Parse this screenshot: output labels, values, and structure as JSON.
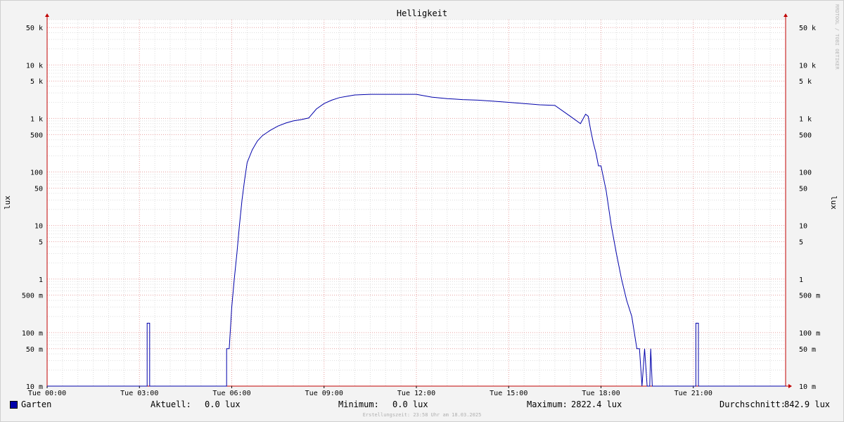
{
  "chart_data": {
    "type": "line",
    "title": "Helligkeit",
    "ylabel": "lux",
    "xlabel": "",
    "y_scale": "log",
    "ylim": [
      0.01,
      70000
    ],
    "xlim_hours": [
      0,
      24
    ],
    "x_ticks": [
      {
        "hour": 0,
        "label": "Tue 00:00"
      },
      {
        "hour": 3,
        "label": "Tue 03:00"
      },
      {
        "hour": 6,
        "label": "Tue 06:00"
      },
      {
        "hour": 9,
        "label": "Tue 09:00"
      },
      {
        "hour": 12,
        "label": "Tue 12:00"
      },
      {
        "hour": 15,
        "label": "Tue 15:00"
      },
      {
        "hour": 18,
        "label": "Tue 18:00"
      },
      {
        "hour": 21,
        "label": "Tue 21:00"
      }
    ],
    "y_ticks": [
      {
        "value": 0.01,
        "label": "10 m"
      },
      {
        "value": 0.05,
        "label": "50 m"
      },
      {
        "value": 0.1,
        "label": "100 m"
      },
      {
        "value": 0.5,
        "label": "500 m"
      },
      {
        "value": 1,
        "label": "1"
      },
      {
        "value": 5,
        "label": "5"
      },
      {
        "value": 10,
        "label": "10"
      },
      {
        "value": 50,
        "label": "50"
      },
      {
        "value": 100,
        "label": "100"
      },
      {
        "value": 500,
        "label": "500"
      },
      {
        "value": 1000,
        "label": "1 k"
      },
      {
        "value": 5000,
        "label": "5 k"
      },
      {
        "value": 10000,
        "label": "10 k"
      },
      {
        "value": 50000,
        "label": "50 k"
      }
    ],
    "grid": true,
    "series": [
      {
        "name": "Garten",
        "color": "#0000aa",
        "x": [
          "00:00",
          "03:15",
          "03:15",
          "03:20",
          "03:20",
          "05:50",
          "05:50",
          "05:55",
          "05:57",
          "06:00",
          "06:05",
          "06:10",
          "06:15",
          "06:20",
          "06:25",
          "06:30",
          "06:40",
          "06:50",
          "07:00",
          "07:15",
          "07:30",
          "07:45",
          "08:00",
          "08:15",
          "08:30",
          "08:45",
          "09:00",
          "09:15",
          "09:30",
          "09:45",
          "10:00",
          "10:30",
          "11:00",
          "11:30",
          "12:00",
          "12:30",
          "13:00",
          "13:15",
          "13:30",
          "14:00",
          "14:30",
          "15:00",
          "15:30",
          "16:00",
          "16:30",
          "17:00",
          "17:20",
          "17:30",
          "17:35",
          "17:40",
          "17:45",
          "17:50",
          "17:55",
          "18:00",
          "18:10",
          "18:20",
          "18:30",
          "18:40",
          "18:50",
          "19:00",
          "19:10",
          "19:15",
          "19:20",
          "19:25",
          "19:30",
          "19:35",
          "19:37",
          "19:40",
          "19:42",
          "19:45",
          "19:50",
          "19:52",
          "19:55",
          "20:00",
          "21:05",
          "21:05",
          "21:10",
          "21:10",
          "24:00"
        ],
        "y": [
          0.01,
          0.01,
          0.15,
          0.15,
          0.01,
          0.01,
          0.05,
          0.05,
          0.1,
          0.3,
          1,
          3,
          10,
          30,
          70,
          150,
          260,
          380,
          480,
          600,
          720,
          820,
          900,
          950,
          1020,
          1500,
          1900,
          2200,
          2450,
          2600,
          2750,
          2822,
          2822,
          2822,
          2822,
          2500,
          2350,
          2300,
          2250,
          2200,
          2100,
          2000,
          1900,
          1800,
          1750,
          1100,
          800,
          1200,
          1100,
          600,
          350,
          230,
          130,
          130,
          45,
          10,
          3,
          1,
          0.4,
          0.2,
          0.05,
          0.05,
          0.01,
          0.05,
          0.01,
          0.01,
          0.05,
          0.01,
          0.01,
          0.01,
          0.01,
          0.01,
          0.01,
          0.01,
          0.01,
          0.15,
          0.15,
          0.01,
          0.01
        ]
      }
    ]
  },
  "legend": {
    "series_name": "Garten",
    "current_label": "Aktuell:",
    "current_value": "0.0 lux",
    "min_label": "Minimum:",
    "min_value": "0.0 lux",
    "max_label": "Maximum:",
    "max_value": "2822.4 lux",
    "avg_label": "Durchschnitt:",
    "avg_value": "842.9 lux"
  },
  "footer": {
    "created": "Erstellungszeit: 23:58 Uhr am 18.03.2025"
  },
  "watermark": "RRDTOOL / TOBI OETIKER",
  "colors": {
    "plot_background": "#ffffff",
    "grid_minor": "#dddddd",
    "grid_major": "#e8a0a0",
    "axis": "#c00000",
    "line": "#0000aa"
  }
}
